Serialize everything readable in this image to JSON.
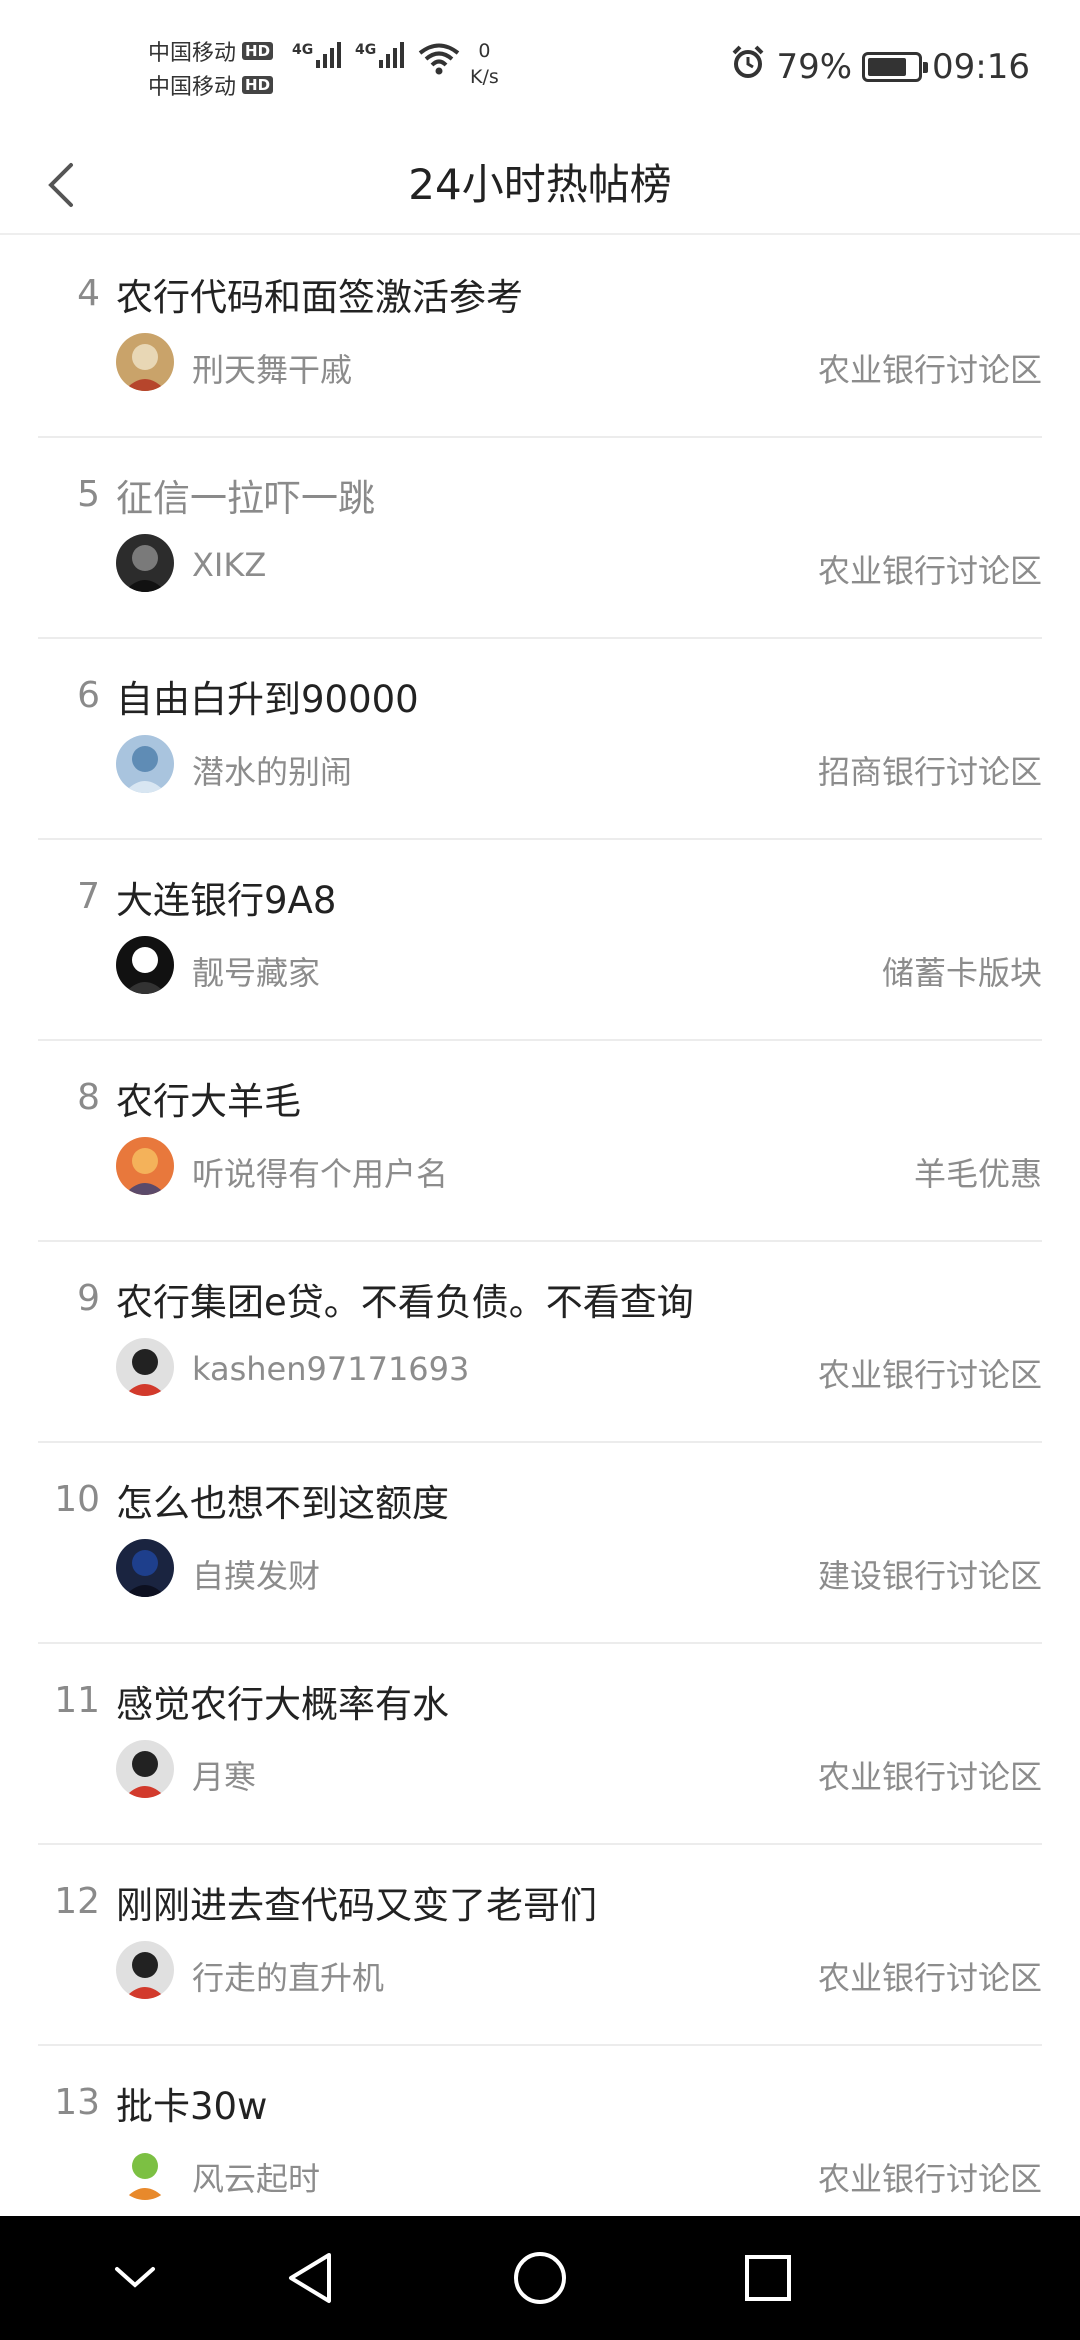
{
  "status_bar": {
    "carrier1": "中国移动",
    "carrier2": "中国移动",
    "hd": "HD",
    "net1": "4G",
    "net2": "4G",
    "speed_value": "0",
    "speed_unit": "K/s",
    "battery_percent": "79%",
    "battery_level": 0.79,
    "time": "09:16"
  },
  "header": {
    "title": "24小时热帖榜"
  },
  "posts": [
    {
      "rank": "4",
      "title": "农行代码和面签激活参考",
      "author": "刑天舞干戚",
      "board": "农业银行讨论区",
      "visited": false,
      "avatar_colors": [
        "#c9a36a",
        "#e8d7b5",
        "#b6452c"
      ]
    },
    {
      "rank": "5",
      "title": "征信一拉吓一跳",
      "author": "XIKZ",
      "board": "农业银行讨论区",
      "visited": true,
      "avatar_colors": [
        "#2c2c2c",
        "#7a7a7a",
        "#111111"
      ]
    },
    {
      "rank": "6",
      "title": "自由白升到90000",
      "author": "潜水的别闹",
      "board": "招商银行讨论区",
      "visited": false,
      "avatar_colors": [
        "#a9c4de",
        "#5f8cb5",
        "#d8e6f2"
      ]
    },
    {
      "rank": "7",
      "title": "大连银行9A8",
      "author": "靓号藏家",
      "board": "储蓄卡版块",
      "visited": false,
      "avatar_colors": [
        "#111111",
        "#ffffff",
        "#333333"
      ]
    },
    {
      "rank": "8",
      "title": "农行大羊毛",
      "author": "听说得有个用户名",
      "board": "羊毛优惠",
      "visited": false,
      "avatar_colors": [
        "#e8783c",
        "#f4b25a",
        "#5b4a6a"
      ]
    },
    {
      "rank": "9",
      "title": "农行集团e贷。不看负债。不看查询",
      "author": "kashen97171693",
      "board": "农业银行讨论区",
      "visited": false,
      "avatar_colors": [
        "#e0e0e0",
        "#222222",
        "#d23a2c"
      ]
    },
    {
      "rank": "10",
      "title": "怎么也想不到这额度",
      "author": "自摸发财",
      "board": "建设银行讨论区",
      "visited": false,
      "avatar_colors": [
        "#1a2440",
        "#1e3f8c",
        "#0d1020"
      ]
    },
    {
      "rank": "11",
      "title": "感觉农行大概率有水",
      "author": "月寒",
      "board": "农业银行讨论区",
      "visited": false,
      "avatar_colors": [
        "#e0e0e0",
        "#222222",
        "#d23a2c"
      ]
    },
    {
      "rank": "12",
      "title": "刚刚进去查代码又变了老哥们",
      "author": "行走的直升机",
      "board": "农业银行讨论区",
      "visited": false,
      "avatar_colors": [
        "#e0e0e0",
        "#222222",
        "#d23a2c"
      ]
    },
    {
      "rank": "13",
      "title": "批卡30w",
      "author": "风云起时",
      "board": "农业银行讨论区",
      "visited": false,
      "avatar_colors": [
        "#ffffff",
        "#7cc043",
        "#e8892b"
      ]
    }
  ]
}
